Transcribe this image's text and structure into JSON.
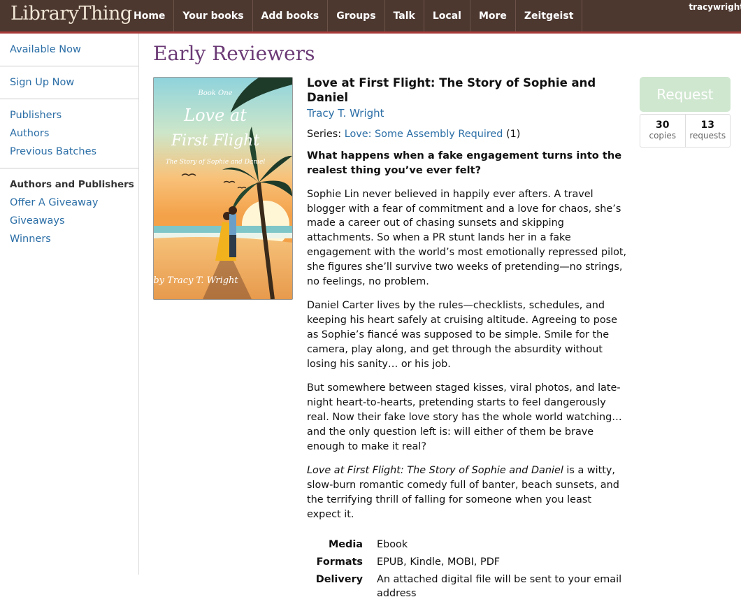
{
  "header": {
    "logo": "LibraryThing",
    "nav": [
      "Home",
      "Your books",
      "Add books",
      "Groups",
      "Talk",
      "Local",
      "More",
      "Zeitgeist"
    ],
    "user": "tracywright"
  },
  "sidebar": {
    "group1": [
      "Available Now"
    ],
    "group2": [
      "Sign Up Now"
    ],
    "group3": [
      "Publishers",
      "Authors",
      "Previous Batches"
    ],
    "group4_heading": "Authors and Publishers",
    "group4": [
      "Offer A Giveaway",
      "Giveaways",
      "Winners"
    ]
  },
  "page_title": "Early Reviewers",
  "book": {
    "title": "Love at First Flight: The Story of Sophie and Daniel",
    "author": "Tracy T. Wright",
    "series_label": "Series:",
    "series_name": "Love: Some Assembly Required",
    "series_number": "(1)",
    "cover": {
      "kicker": "Book One",
      "title_line1": "Love at",
      "title_line2": "First Flight",
      "subtitle": "The Story of Sophie and Daniel",
      "byline": "by Tracy T. Wright"
    },
    "tagline": "What happens when a fake engagement turns into the realest thing you’ve ever felt?",
    "paragraphs": [
      "Sophie Lin never believed in happily ever afters. A travel blogger with a fear of commitment and a love for chaos, she’s made a career out of chasing sunsets and skipping attachments. So when a PR stunt lands her in a fake engagement with the world’s most emotionally repressed pilot, she figures she’ll survive two weeks of pretending—no strings, no feelings, no problem.",
      "Daniel Carter lives by the rules—checklists, schedules, and keeping his heart safely at cruising altitude. Agreeing to pose as Sophie’s fiancé was supposed to be simple. Smile for the camera, play along, and get through the absurdity without losing his sanity… or his job.",
      "But somewhere between staged kisses, viral photos, and late-night heart-to-hearts, pretending starts to feel dangerously real. Now their fake love story has the whole world watching… and the only question left is: will either of them be brave enough to make it real?"
    ],
    "closing_italic": "Love at First Flight: The Story of Sophie and Daniel",
    "closing_rest": " is a witty, slow-burn romantic comedy full of banter, beach sunsets, and the terrifying thrill of falling for someone when you least expect it.",
    "specs": [
      {
        "label": "Media",
        "value": "Ebook"
      },
      {
        "label": "Formats",
        "value": "EPUB, Kindle, MOBI, PDF"
      },
      {
        "label": "Delivery",
        "value": "An attached digital file will be sent to your email address"
      }
    ]
  },
  "request": {
    "label": "Request",
    "copies": "30",
    "copies_label": "copies",
    "requests": "13",
    "requests_label": "requests"
  },
  "colors": {
    "topbar": "#4d3830",
    "accent_line": "#a83a3a",
    "link": "#2b6ea6",
    "title": "#6b3a75",
    "request_button": "#cfe6cf"
  }
}
